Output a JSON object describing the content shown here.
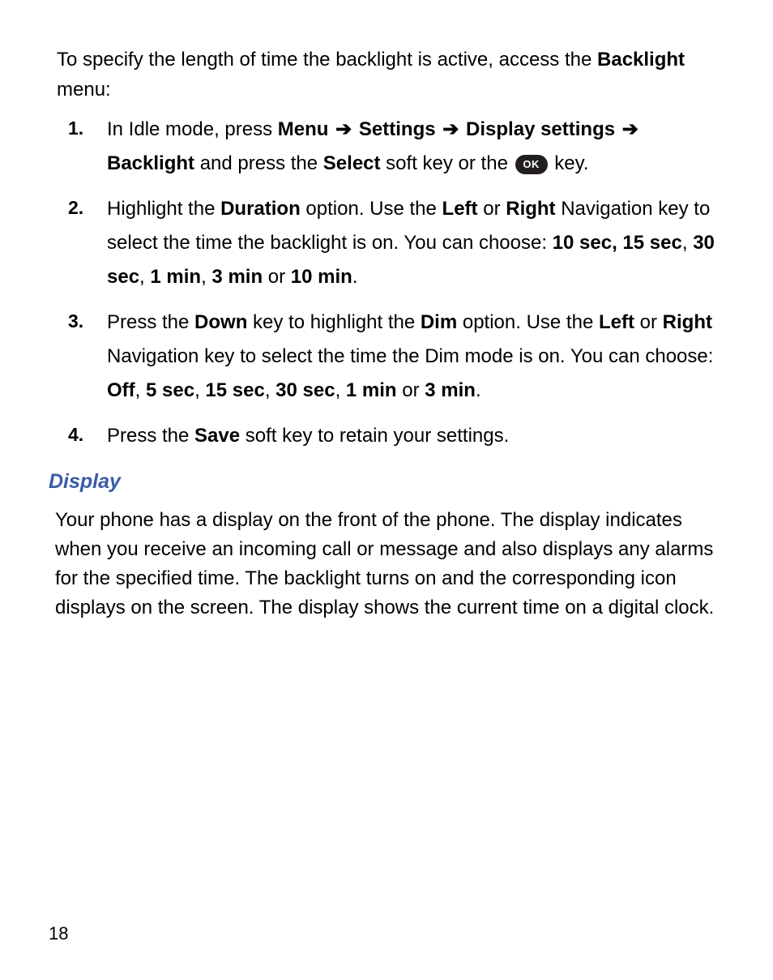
{
  "intro": {
    "pre": "To specify the length of time the backlight is active, access the ",
    "bold": "Backlight",
    "post": " menu:"
  },
  "steps": [
    {
      "num": "1.",
      "parts": [
        {
          "t": "In Idle mode, press "
        },
        {
          "t": "Menu",
          "b": true
        },
        {
          "arrow": true
        },
        {
          "t": "Settings",
          "b": true
        },
        {
          "arrow": true
        },
        {
          "t": "Display settings",
          "b": true
        },
        {
          "arrow": true
        },
        {
          "t": "Backlight",
          "b": true
        },
        {
          "t": " and press the "
        },
        {
          "t": "Select",
          "b": true
        },
        {
          "t": " soft key or the "
        },
        {
          "ok": true
        },
        {
          "t": " key."
        }
      ]
    },
    {
      "num": "2.",
      "parts": [
        {
          "t": "Highlight the "
        },
        {
          "t": "Duration",
          "b": true
        },
        {
          "t": " option. Use the "
        },
        {
          "t": "Left",
          "b": true
        },
        {
          "t": " or "
        },
        {
          "t": "Right",
          "b": true
        },
        {
          "t": " Navigation key to select the time the backlight is on. You can choose: "
        },
        {
          "t": "10 sec, 15 sec",
          "b": true
        },
        {
          "t": ", "
        },
        {
          "t": "30 sec",
          "b": true
        },
        {
          "t": ", "
        },
        {
          "t": "1 min",
          "b": true
        },
        {
          "t": ", "
        },
        {
          "t": "3 min",
          "b": true
        },
        {
          "t": " or "
        },
        {
          "t": "10 min",
          "b": true
        },
        {
          "t": "."
        }
      ]
    },
    {
      "num": "3.",
      "parts": [
        {
          "t": "Press the "
        },
        {
          "t": "Down",
          "b": true
        },
        {
          "t": " key to highlight the "
        },
        {
          "t": "Dim",
          "b": true
        },
        {
          "t": " option. Use the "
        },
        {
          "t": "Left",
          "b": true
        },
        {
          "t": " or "
        },
        {
          "t": "Right",
          "b": true
        },
        {
          "t": " Navigation key to select the time the Dim mode is on. You can choose: "
        },
        {
          "t": "Off",
          "b": true
        },
        {
          "t": ", "
        },
        {
          "t": "5 sec",
          "b": true
        },
        {
          "t": ", "
        },
        {
          "t": "15 sec",
          "b": true
        },
        {
          "t": ", "
        },
        {
          "t": "30 sec",
          "b": true
        },
        {
          "t": ", "
        },
        {
          "t": "1 min",
          "b": true
        },
        {
          "t": " or "
        },
        {
          "t": "3 min",
          "b": true
        },
        {
          "t": "."
        }
      ]
    },
    {
      "num": "4.",
      "parts": [
        {
          "t": "Press the "
        },
        {
          "t": "Save",
          "b": true
        },
        {
          "t": " soft key to retain your settings."
        }
      ]
    }
  ],
  "section_heading": "Display",
  "body_para": "Your phone has a display on the front of the phone. The display indicates when you receive an incoming call or message and also displays any alarms for the specified time. The backlight turns on and the corresponding icon displays on the screen. The display shows the current time on a digital clock.",
  "page_number": "18",
  "arrow_glyph": "➔",
  "ok_label": "OK"
}
